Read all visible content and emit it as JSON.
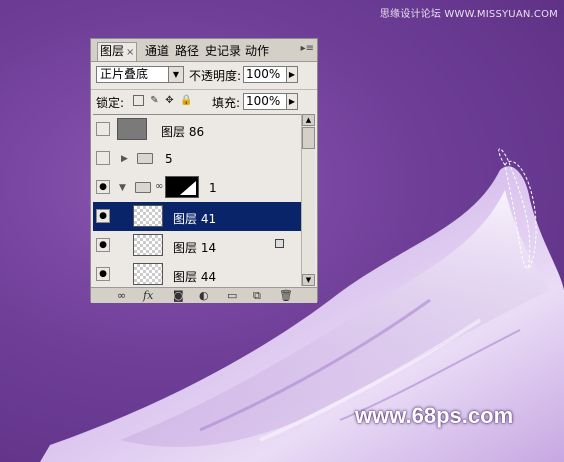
{
  "watermarks": {
    "top": "思缘设计论坛 WWW.MISSYUAN.COM",
    "bottom": "www.68ps.com"
  },
  "panel": {
    "tabs": [
      {
        "label": "图层",
        "active": true
      },
      {
        "label": "通道",
        "active": false
      },
      {
        "label": "路径",
        "active": false
      },
      {
        "label": "史记录",
        "active": false
      },
      {
        "label": "动作",
        "active": false
      }
    ],
    "tab_close": "×",
    "menu_glyph": "▸≡",
    "blend_mode": "正片叠底",
    "opacity_label": "不透明度:",
    "opacity_value": "100%",
    "lock_label": "锁定:",
    "fill_label": "填充:",
    "fill_value": "100%",
    "layers": [
      {
        "name": "图层 86",
        "visible": false,
        "type": "layer"
      },
      {
        "name": "5",
        "visible": false,
        "type": "group"
      },
      {
        "name": "1",
        "visible": true,
        "type": "group-mask"
      },
      {
        "name": "图层 41",
        "visible": true,
        "type": "layer",
        "selected": true
      },
      {
        "name": "图层 14",
        "visible": true,
        "type": "layer",
        "locked": true
      },
      {
        "name": "图层 44",
        "visible": true,
        "type": "layer"
      }
    ]
  },
  "colors": {
    "background": "#6f3f98",
    "selection": "#0a2469",
    "fabric": "#e6d6f2"
  }
}
